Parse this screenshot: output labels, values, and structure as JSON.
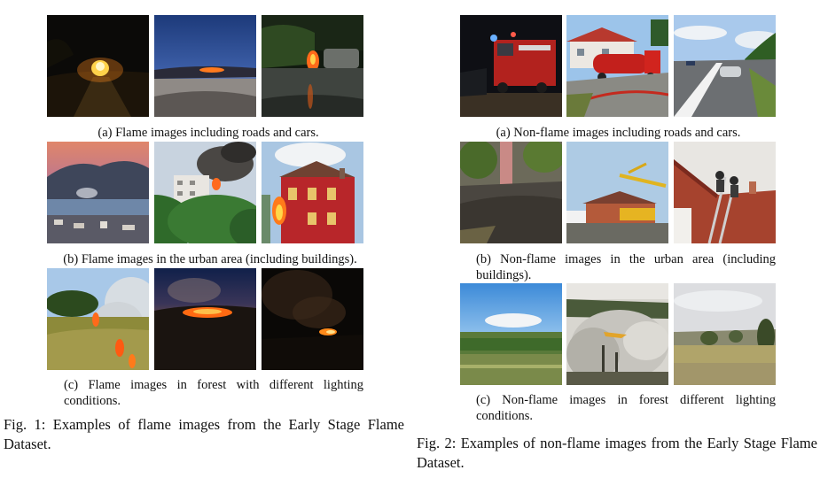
{
  "fig1": {
    "row_a_caption": "(a) Flame images including roads and cars.",
    "row_b_caption": "(b) Flame images in the urban area (including buildings).",
    "row_c_caption": "(c) Flame images in forest with different lighting conditions.",
    "caption": "Fig. 1: Examples of flame images from the Early Stage Flame Dataset."
  },
  "fig2": {
    "row_a_caption": "(a) Non-flame images including roads and cars.",
    "row_b_caption": "(b) Non-flame images in the urban area (including buildings).",
    "row_c_caption": "(c) Non-flame images in forest different lighting conditions.",
    "caption": "Fig. 2: Examples of non-flame images from the Early Stage Flame Dataset."
  }
}
